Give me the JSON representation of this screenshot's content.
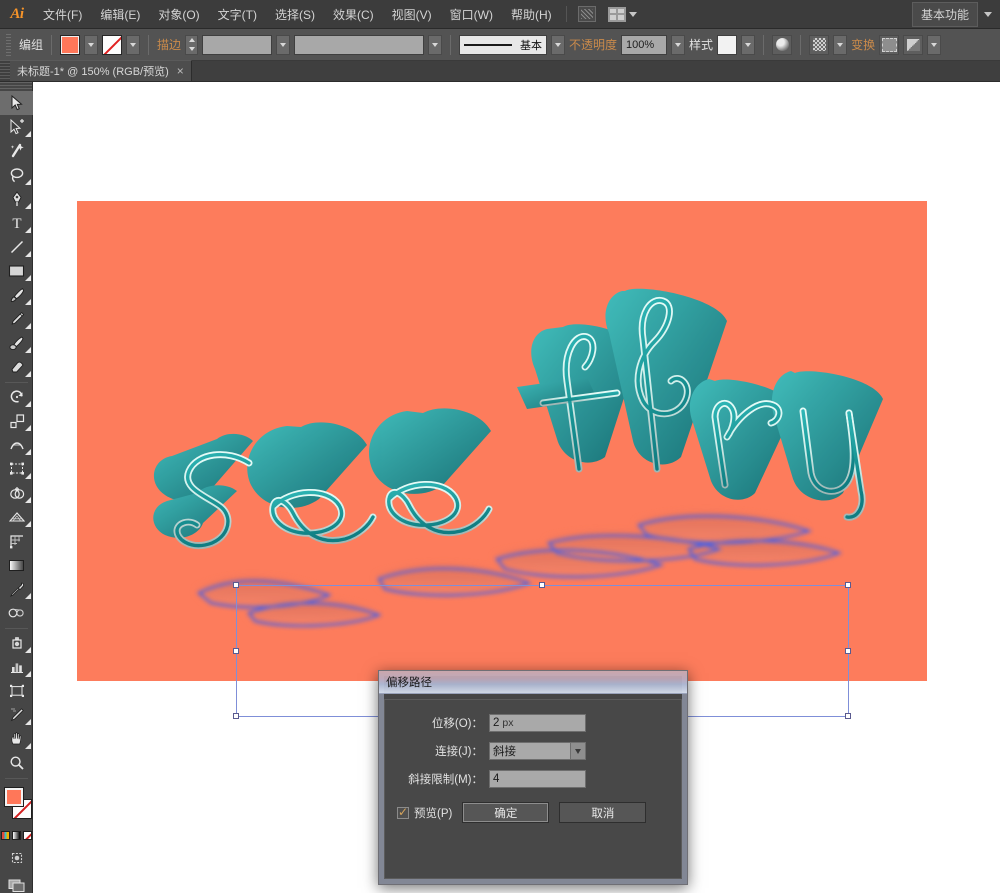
{
  "app": {
    "logo": "Ai",
    "workspace": "基本功能"
  },
  "menubar": {
    "items": [
      {
        "label": "文件(F)",
        "name": "menu-file"
      },
      {
        "label": "编辑(E)",
        "name": "menu-edit"
      },
      {
        "label": "对象(O)",
        "name": "menu-object"
      },
      {
        "label": "文字(T)",
        "name": "menu-type"
      },
      {
        "label": "选择(S)",
        "name": "menu-select"
      },
      {
        "label": "效果(C)",
        "name": "menu-effect"
      },
      {
        "label": "视图(V)",
        "name": "menu-view"
      },
      {
        "label": "窗口(W)",
        "name": "menu-window"
      },
      {
        "label": "帮助(H)",
        "name": "menu-help"
      }
    ]
  },
  "controlbar": {
    "selection_label": "编组",
    "fill_color": "#ff7759",
    "stroke_label": "描边",
    "stroke_weight": "",
    "stroke_profile": "",
    "brush_label": "基本",
    "opacity_label": "不透明度",
    "opacity_value": "100%",
    "style_label": "样式",
    "transform_label": "变换"
  },
  "tabs": {
    "document": "未标题-1* @ 150% (RGB/预览)",
    "close": "×"
  },
  "toolbar": {
    "tools": [
      {
        "name": "selection-tool",
        "label": "选择工具"
      },
      {
        "name": "direct-selection-tool",
        "label": "直接选择工具"
      },
      {
        "name": "magic-wand-tool",
        "label": "魔棒工具"
      },
      {
        "name": "lasso-tool",
        "label": "套索工具"
      },
      {
        "name": "pen-tool",
        "label": "钢笔工具"
      },
      {
        "name": "type-tool",
        "label": "文字工具"
      },
      {
        "name": "line-segment-tool",
        "label": "直线段工具"
      },
      {
        "name": "rectangle-tool",
        "label": "矩形工具"
      },
      {
        "name": "paintbrush-tool",
        "label": "画笔工具"
      },
      {
        "name": "pencil-tool",
        "label": "铅笔工具"
      },
      {
        "name": "blob-brush-tool",
        "label": "斑点画笔工具"
      },
      {
        "name": "eraser-tool",
        "label": "橡皮擦工具"
      },
      {
        "name": "rotate-tool",
        "label": "旋转工具"
      },
      {
        "name": "scale-tool",
        "label": "比例缩放工具"
      },
      {
        "name": "width-tool",
        "label": "宽度工具"
      },
      {
        "name": "free-transform-tool",
        "label": "自由变换工具"
      },
      {
        "name": "shape-builder-tool",
        "label": "形状生成器工具"
      },
      {
        "name": "perspective-grid-tool",
        "label": "透视网格工具"
      },
      {
        "name": "mesh-tool",
        "label": "网格工具"
      },
      {
        "name": "gradient-tool",
        "label": "渐变工具"
      },
      {
        "name": "eyedropper-tool",
        "label": "吸管工具"
      },
      {
        "name": "blend-tool",
        "label": "混合工具"
      },
      {
        "name": "symbol-sprayer-tool",
        "label": "符号喷枪工具"
      },
      {
        "name": "column-graph-tool",
        "label": "柱形图工具"
      },
      {
        "name": "artboard-tool",
        "label": "画板工具"
      },
      {
        "name": "slice-tool",
        "label": "切片工具"
      },
      {
        "name": "hand-tool",
        "label": "抓手工具"
      },
      {
        "name": "zoom-tool",
        "label": "缩放工具"
      }
    ],
    "fill_color": "#ff7759",
    "stroke_color": "none"
  },
  "canvas": {
    "artboard_color": "#fd7c5c",
    "artwork_text": "see thru",
    "artwork_fill": "#1f9ea5",
    "artwork_outline": "#d8f6f2",
    "selection_color": "#7f8fd8"
  },
  "dialog": {
    "title": "偏移路径",
    "fields": [
      {
        "label": "位移(O)：",
        "value": "2",
        "unit": "px",
        "type": "input",
        "name": "offset-field"
      },
      {
        "label": "连接(J)：",
        "value": "斜接",
        "unit": "",
        "type": "select",
        "name": "joins-select"
      },
      {
        "label": "斜接限制(M)：",
        "value": "4",
        "unit": "",
        "type": "input",
        "name": "miter-limit-field"
      }
    ],
    "preview_label": "预览(P)",
    "preview_checked": true,
    "ok_label": "确定",
    "cancel_label": "取消"
  }
}
